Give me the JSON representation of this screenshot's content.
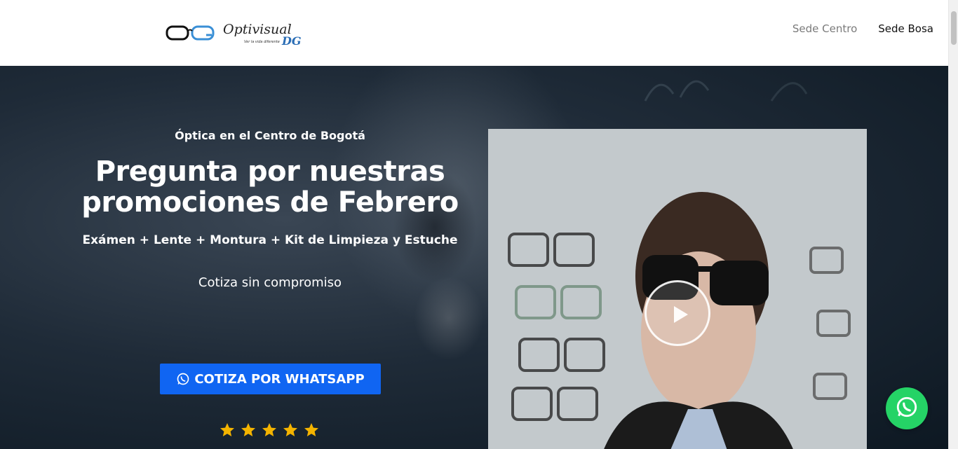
{
  "header": {
    "logo": {
      "alt": "Optivisual DG",
      "brand_text": "Optivisual",
      "brand_suffix": "DG",
      "tagline": "Ver la vida diferente"
    },
    "nav": [
      {
        "label": "Sede Centro",
        "active": false
      },
      {
        "label": "Sede Bosa",
        "active": true
      }
    ]
  },
  "hero": {
    "eyebrow": "Óptica en el Centro de Bogotá",
    "headline": "Pregunta por nuestras promociones de Febrero",
    "subhead": "Exámen + Lente + Montura + Kit de Limpieza y Estuche",
    "cta_text": "Cotiza sin compromiso",
    "button_label": "COTIZA POR WHATSAPP",
    "rating_stars": 5,
    "star_color": "#f4b400",
    "button_color": "#1065f2"
  },
  "video": {
    "play_icon": "play-icon"
  },
  "floating": {
    "icon": "whatsapp-icon",
    "color": "#25d366"
  }
}
